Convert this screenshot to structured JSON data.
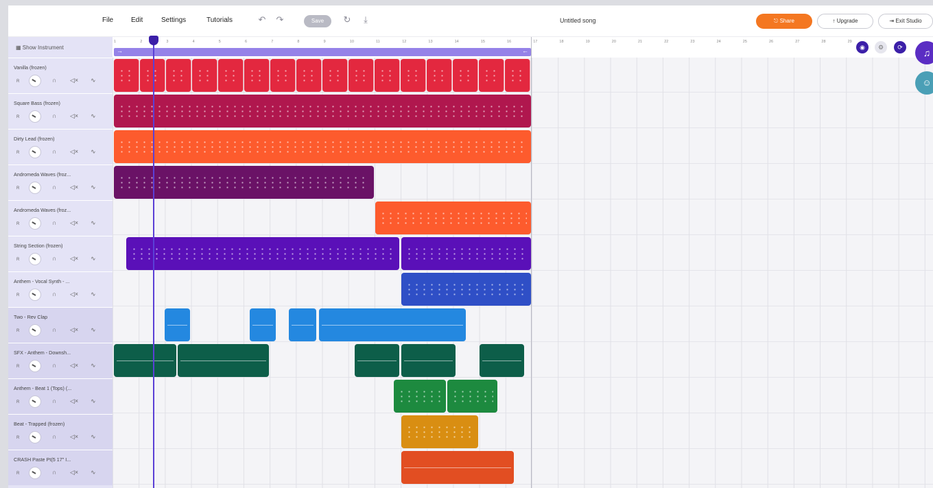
{
  "menu": [
    "File",
    "Edit",
    "Settings",
    "Tutorials"
  ],
  "toolbar": {
    "save_label": "Save",
    "song_title": "Untitled song",
    "share_label": "Share",
    "upgrade_label": "Upgrade",
    "exit_label": "Exit Studio"
  },
  "sidebar": {
    "show_instrument": "Show Instrument"
  },
  "ruler": [
    "1",
    "2",
    "3",
    "4",
    "5",
    "6",
    "7",
    "8",
    "9",
    "10",
    "11",
    "12",
    "13",
    "14",
    "15",
    "16",
    "17",
    "18",
    "19",
    "20",
    "21",
    "22",
    "23",
    "24",
    "25",
    "26",
    "27",
    "28",
    "29"
  ],
  "tracks": [
    {
      "name": "Vanilla (frozen)"
    },
    {
      "name": "Square Bass (frozen)"
    },
    {
      "name": "Dirty Lead (frozen)"
    },
    {
      "name": "Andromeda Waves (froz..."
    },
    {
      "name": "Andromeda Waves (froz..."
    },
    {
      "name": "String Section (frozen)"
    },
    {
      "name": "Anthem - Vocal Synth - ..."
    },
    {
      "name": "Two - Rev Clap"
    },
    {
      "name": "SFX - Anthem - Downsh..."
    },
    {
      "name": "Anthem - Beat 1 (Tops) (..."
    },
    {
      "name": "Beat - Trapped (frozen)"
    },
    {
      "name": "CRASH Paste Pt(5 17\" I..."
    }
  ],
  "colors": {
    "accent": "#f47721",
    "playhead": "#5b3fd6",
    "loop": "#9582e8",
    "sidebar": "#e4e3f6"
  },
  "icons": {
    "undo": "undo-icon",
    "redo": "redo-icon",
    "refresh": "refresh-icon",
    "download": "download-icon"
  }
}
